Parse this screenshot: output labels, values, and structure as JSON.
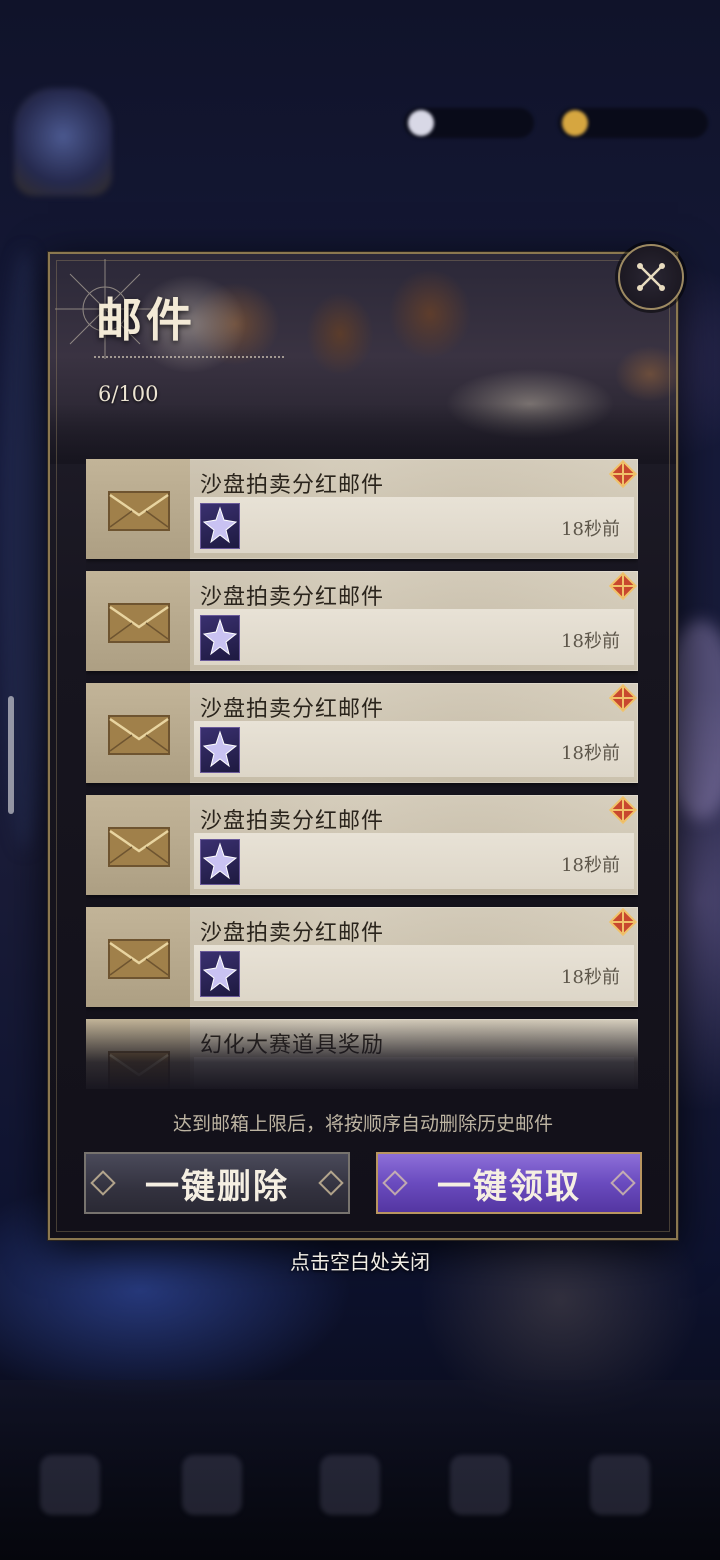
{
  "mail": {
    "title": "邮件",
    "count": "6/100",
    "items": [
      {
        "title": "沙盘拍卖分红邮件",
        "time": "18秒前"
      },
      {
        "title": "沙盘拍卖分红邮件",
        "time": "18秒前"
      },
      {
        "title": "沙盘拍卖分红邮件",
        "time": "18秒前"
      },
      {
        "title": "沙盘拍卖分红邮件",
        "time": "18秒前"
      },
      {
        "title": "沙盘拍卖分红邮件",
        "time": "18秒前"
      },
      {
        "title": "幻化大赛道具奖励",
        "time": ""
      }
    ],
    "notice": "达到邮箱上限后，将按顺序自动删除历史邮件",
    "delete_all": "一键删除",
    "claim_all": "一键领取"
  },
  "hint": "点击空白处关闭",
  "icons": {
    "close": "close-x-icon",
    "envelope": "envelope-icon",
    "gift": "gift-badge-icon",
    "attachment": "star-crystal-icon"
  },
  "colors": {
    "panel_border": "#8b7850",
    "claim_button": "#6a4bbf",
    "delete_button": "#33323f",
    "mail_card": "#d7cfbe"
  }
}
